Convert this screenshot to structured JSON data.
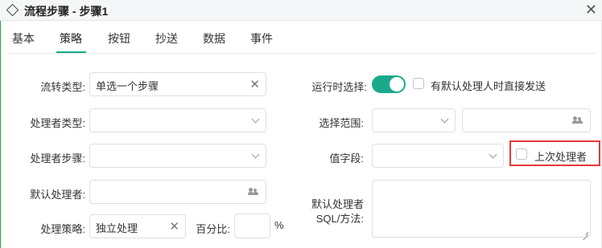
{
  "window": {
    "title": "流程步骤 - 步骤1",
    "close_icon": "close-icon",
    "title_icon": "diamond-icon"
  },
  "tabs": [
    {
      "label": "基本",
      "active": false
    },
    {
      "label": "策略",
      "active": true
    },
    {
      "label": "按钮",
      "active": false
    },
    {
      "label": "抄送",
      "active": false
    },
    {
      "label": "数据",
      "active": false
    },
    {
      "label": "事件",
      "active": false
    }
  ],
  "accent_color": "#1aaa8a",
  "highlight_color": "#e53935",
  "left_form": {
    "flow_type": {
      "label": "流转类型:",
      "value": "单选一个步骤"
    },
    "handler_type": {
      "label": "处理者类型:",
      "value": ""
    },
    "handler_step": {
      "label": "处理者步骤:",
      "value": ""
    },
    "default_handler": {
      "label": "默认处理者:",
      "value": ""
    },
    "handle_strategy": {
      "label": "处理策略:",
      "value": "独立处理"
    },
    "percentage": {
      "label": "百分比:",
      "value": "",
      "unit": "%"
    }
  },
  "right_form": {
    "runtime_select": {
      "label": "运行时选择:",
      "enabled": true
    },
    "send_directly": {
      "label": "有默认处理人时直接发送",
      "checked": false
    },
    "select_range": {
      "label": "选择范围:",
      "value": "",
      "value2": ""
    },
    "value_field": {
      "label": "值字段:",
      "value": ""
    },
    "last_handler": {
      "label": "上次处理者",
      "checked": false
    },
    "default_sql": {
      "label_line1": "默认处理者",
      "label_line2": "SQL/方法:",
      "value": ""
    }
  }
}
